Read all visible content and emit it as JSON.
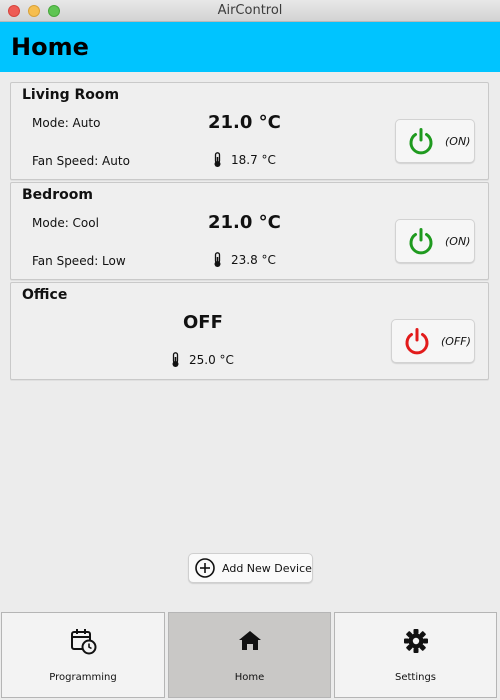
{
  "window": {
    "title": "AirControl"
  },
  "header": {
    "title": "Home"
  },
  "devices": [
    {
      "name": "Living Room",
      "mode_label": "Mode: Auto",
      "fan_label": "Fan Speed: Auto",
      "set_temp": "21.0 °C",
      "current_temp": "18.7 °C",
      "state": "on",
      "state_label": "(ON)",
      "icon_color": "#1f9a1f"
    },
    {
      "name": "Bedroom",
      "mode_label": "Mode: Cool",
      "fan_label": "Fan Speed: Low",
      "set_temp": "21.0 °C",
      "current_temp": "23.8 °C",
      "state": "on",
      "state_label": "(ON)",
      "icon_color": "#1f9a1f"
    },
    {
      "name": "Office",
      "status": "OFF",
      "current_temp": "25.0 °C",
      "state": "off",
      "state_label": "(OFF)",
      "icon_color": "#e21b1b"
    }
  ],
  "actions": {
    "add_device_label": "Add New Device",
    "add_icon": "plus-circle-icon"
  },
  "tabs": [
    {
      "label": "Programming",
      "icon": "calendar-clock-icon",
      "active": false
    },
    {
      "label": "Home",
      "icon": "home-icon",
      "active": true
    },
    {
      "label": "Settings",
      "icon": "gear-icon",
      "active": false
    }
  ]
}
